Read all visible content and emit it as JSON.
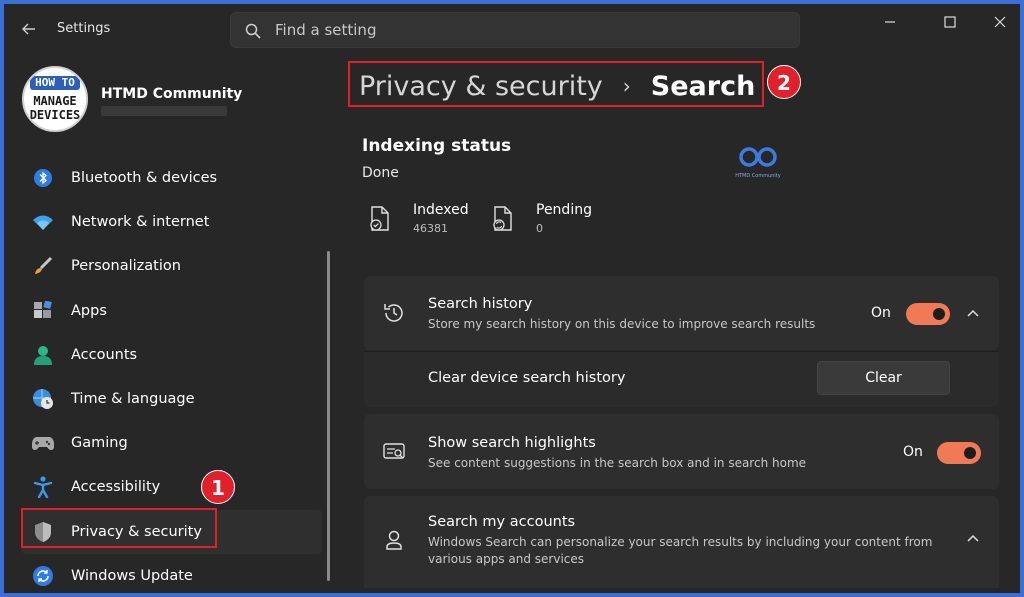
{
  "window": {
    "title": "Settings"
  },
  "search": {
    "placeholder": "Find a setting"
  },
  "profile": {
    "name": "HTMD Community",
    "logo_lines": [
      "HOW TO",
      "MANAGE",
      "DEVICES"
    ]
  },
  "sidebar": {
    "items": [
      {
        "label": "Bluetooth & devices",
        "icon": "bluetooth-icon"
      },
      {
        "label": "Network & internet",
        "icon": "wifi-icon"
      },
      {
        "label": "Personalization",
        "icon": "brush-icon"
      },
      {
        "label": "Apps",
        "icon": "apps-icon"
      },
      {
        "label": "Accounts",
        "icon": "person-icon"
      },
      {
        "label": "Time & language",
        "icon": "globe-clock-icon"
      },
      {
        "label": "Gaming",
        "icon": "gamepad-icon"
      },
      {
        "label": "Accessibility",
        "icon": "accessibility-icon"
      },
      {
        "label": "Privacy & security",
        "icon": "shield-icon",
        "active": true
      },
      {
        "label": "Windows Update",
        "icon": "update-icon"
      }
    ]
  },
  "annotations": {
    "badge1": "1",
    "badge2": "2"
  },
  "breadcrumb": {
    "parent": "Privacy & security",
    "separator": "›",
    "current": "Search"
  },
  "indexing": {
    "title": "Indexing status",
    "state": "Done",
    "indexed_label": "Indexed",
    "indexed_value": "46381",
    "pending_label": "Pending",
    "pending_value": "0",
    "watermark": "HTMD Community"
  },
  "cards": {
    "search_history": {
      "title": "Search history",
      "desc": "Store my search history on this device to improve search results",
      "state": "On"
    },
    "clear_history": {
      "label": "Clear device search history",
      "button": "Clear"
    },
    "highlights": {
      "title": "Show search highlights",
      "desc": "See content suggestions in the search box and in search home",
      "state": "On"
    },
    "accounts": {
      "title": "Search my accounts",
      "desc": "Windows Search can personalize your search results by including your content from various apps and services"
    }
  },
  "colors": {
    "accent": "#f07a55",
    "highlight": "#e0202b",
    "background": "#272727",
    "card": "#2e2e2e"
  }
}
